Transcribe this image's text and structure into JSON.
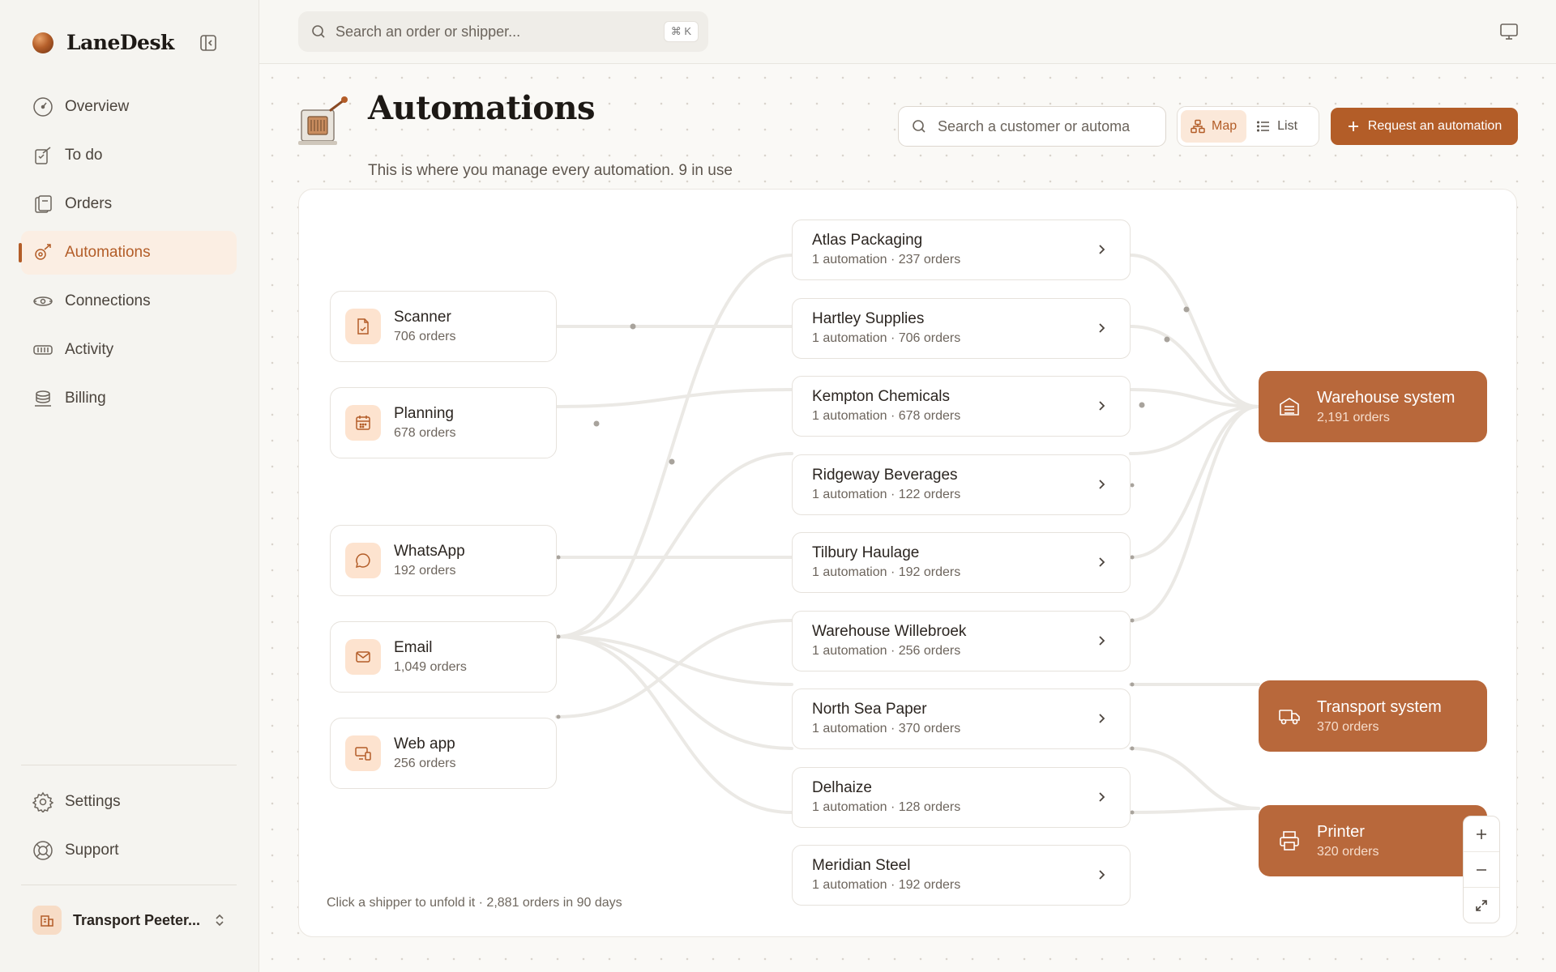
{
  "app": {
    "name": "LaneDesk"
  },
  "sidebar": {
    "items": [
      {
        "label": "Overview",
        "icon": "gauge-icon"
      },
      {
        "label": "To do",
        "icon": "todo-icon"
      },
      {
        "label": "Orders",
        "icon": "orders-icon"
      },
      {
        "label": "Automations",
        "icon": "automations-icon",
        "active": true
      },
      {
        "label": "Connections",
        "icon": "connections-icon"
      },
      {
        "label": "Activity",
        "icon": "activity-icon"
      },
      {
        "label": "Billing",
        "icon": "billing-icon"
      }
    ],
    "bottom": [
      {
        "label": "Settings",
        "icon": "gear-icon"
      },
      {
        "label": "Support",
        "icon": "lifebuoy-icon"
      }
    ],
    "workspace": "Transport Peeter..."
  },
  "topbar": {
    "search_placeholder": "Search an order or shipper...",
    "shortcut": "⌘ K"
  },
  "page": {
    "title": "Automations",
    "subtitle": "This is where you manage every automation. 9 in use",
    "search_placeholder": "Search a customer or automa",
    "view_map": "Map",
    "view_list": "List",
    "active_view": "Map",
    "request_button": "Request an automation"
  },
  "sources": [
    {
      "name": "Scanner",
      "orders": "706 orders",
      "icon": "scanner-icon"
    },
    {
      "name": "Planning",
      "orders": "678 orders",
      "icon": "calendar-icon"
    },
    {
      "name": "WhatsApp",
      "orders": "192 orders",
      "icon": "chat-icon"
    },
    {
      "name": "Email",
      "orders": "1,049 orders",
      "icon": "mail-icon"
    },
    {
      "name": "Web app",
      "orders": "256 orders",
      "icon": "devices-icon"
    }
  ],
  "customers": [
    {
      "name": "Atlas Packaging",
      "detail": "1 automation · 237 orders"
    },
    {
      "name": "Hartley Supplies",
      "detail": "1 automation · 706 orders"
    },
    {
      "name": "Kempton Chemicals",
      "detail": "1 automation · 678 orders"
    },
    {
      "name": "Ridgeway Beverages",
      "detail": "1 automation · 122 orders"
    },
    {
      "name": "Tilbury Haulage",
      "detail": "1 automation · 192 orders"
    },
    {
      "name": "Warehouse Willebroek",
      "detail": "1 automation · 256 orders"
    },
    {
      "name": "North Sea Paper",
      "detail": "1 automation · 370 orders"
    },
    {
      "name": "Delhaize",
      "detail": "1 automation · 128 orders"
    },
    {
      "name": "Meridian Steel",
      "detail": "1 automation · 192 orders"
    }
  ],
  "destinations": [
    {
      "name": "Warehouse system",
      "orders": "2,191 orders",
      "icon": "warehouse-icon"
    },
    {
      "name": "Transport system",
      "orders": "370 orders",
      "icon": "truck-icon"
    },
    {
      "name": "Printer",
      "orders": "320 orders",
      "icon": "printer-icon"
    }
  ],
  "hint": "Click a shipper to unfold it · 2,881 orders in 90 days",
  "colors": {
    "accent": "#b35d28",
    "destination": "#b8683b",
    "active_bg": "#fbeee3"
  }
}
